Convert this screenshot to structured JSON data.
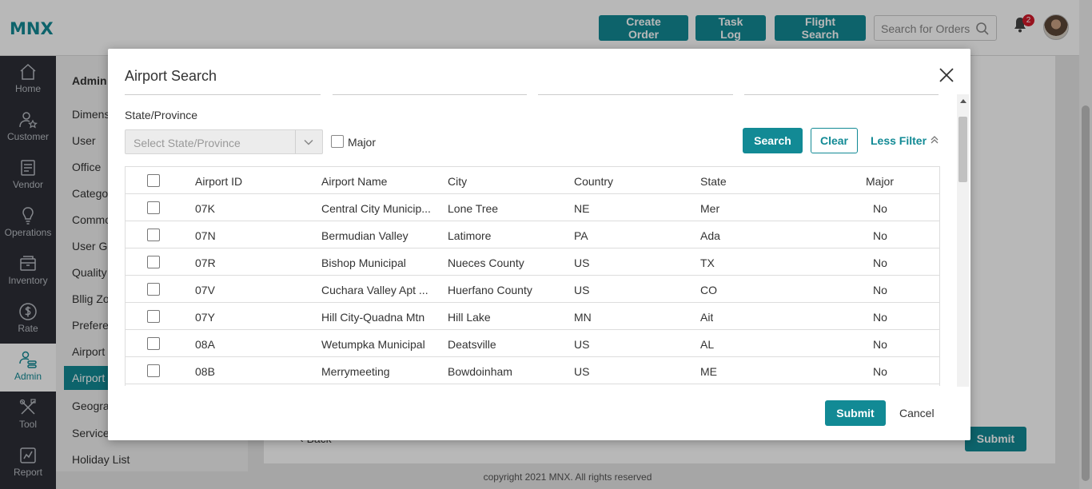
{
  "app": {
    "logo": "MNX",
    "header_buttons": [
      "Create Order",
      "Task Log",
      "Flight Search"
    ],
    "search_placeholder": "Search for Orders",
    "notification_count": "2"
  },
  "sidenav": [
    {
      "label": "Home",
      "icon": "home-icon"
    },
    {
      "label": "Customer",
      "icon": "customer-icon"
    },
    {
      "label": "Vendor",
      "icon": "vendor-icon"
    },
    {
      "label": "Operations",
      "icon": "operations-icon"
    },
    {
      "label": "Inventory",
      "icon": "inventory-icon"
    },
    {
      "label": "Rate",
      "icon": "rate-icon"
    },
    {
      "label": "Admin",
      "icon": "admin-icon",
      "active": true
    },
    {
      "label": "Tool",
      "icon": "tool-icon"
    },
    {
      "label": "Report",
      "icon": "report-icon"
    }
  ],
  "subnav": {
    "title": "Admin",
    "items": [
      "Dimens",
      "User",
      "Office",
      "Catego",
      "Commo",
      "User Gr",
      "Quality",
      "Bllig Zo",
      "Prefere",
      "Airport",
      "Airport",
      "Geogra",
      "Service",
      "Holiday List"
    ],
    "active_index": 10
  },
  "background": {
    "back_label": "Back",
    "submit_label": "Submit",
    "footer": "copyright 2021 MNX. All rights reserved"
  },
  "modal": {
    "title": "Airport Search",
    "state_label": "State/Province",
    "state_placeholder": "Select State/Province",
    "major_label": "Major",
    "search_label": "Search",
    "clear_label": "Clear",
    "less_filter_label": "Less Filter",
    "columns": [
      "Airport ID",
      "Airport Name",
      "City",
      "Country",
      "State",
      "Major"
    ],
    "rows": [
      [
        "07K",
        "Central City Municip...",
        "Lone Tree",
        "NE",
        "Mer",
        "No"
      ],
      [
        "07N",
        "Bermudian Valley",
        "Latimore",
        "PA",
        "Ada",
        "No"
      ],
      [
        "07R",
        "Bishop Municipal",
        "Nueces County",
        "US",
        "TX",
        "No"
      ],
      [
        "07V",
        "Cuchara Valley Apt ...",
        "Huerfano County",
        "US",
        "CO",
        "No"
      ],
      [
        "07Y",
        "Hill City-Quadna Mtn",
        "Hill Lake",
        "MN",
        "Ait",
        "No"
      ],
      [
        "08A",
        "Wetumpka Municipal",
        "Deatsville",
        "US",
        "AL",
        "No"
      ],
      [
        "08B",
        "Merrymeeting",
        "Bowdoinham",
        "US",
        "ME",
        "No"
      ]
    ],
    "submit_label": "Submit",
    "cancel_label": "Cancel"
  },
  "colors": {
    "accent": "#128a95",
    "sidebar": "#2d2f36",
    "badge": "#d11a2a"
  }
}
